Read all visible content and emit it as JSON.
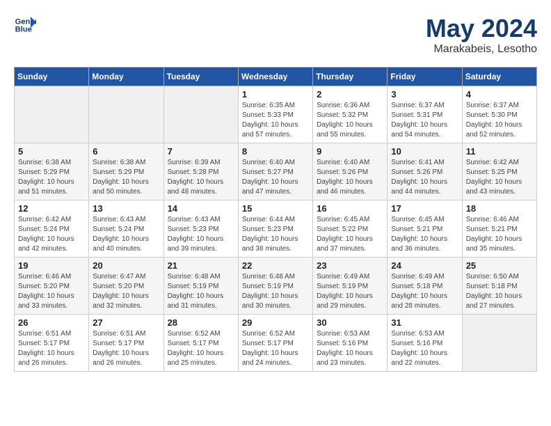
{
  "header": {
    "logo_line1": "General",
    "logo_line2": "Blue",
    "month": "May 2024",
    "location": "Marakabeis, Lesotho"
  },
  "weekdays": [
    "Sunday",
    "Monday",
    "Tuesday",
    "Wednesday",
    "Thursday",
    "Friday",
    "Saturday"
  ],
  "weeks": [
    [
      {
        "day": "",
        "empty": true
      },
      {
        "day": "",
        "empty": true
      },
      {
        "day": "",
        "empty": true
      },
      {
        "day": "1",
        "sunrise": "6:35 AM",
        "sunset": "5:33 PM",
        "daylight": "10 hours and 57 minutes."
      },
      {
        "day": "2",
        "sunrise": "6:36 AM",
        "sunset": "5:32 PM",
        "daylight": "10 hours and 55 minutes."
      },
      {
        "day": "3",
        "sunrise": "6:37 AM",
        "sunset": "5:31 PM",
        "daylight": "10 hours and 54 minutes."
      },
      {
        "day": "4",
        "sunrise": "6:37 AM",
        "sunset": "5:30 PM",
        "daylight": "10 hours and 52 minutes."
      }
    ],
    [
      {
        "day": "5",
        "sunrise": "6:38 AM",
        "sunset": "5:29 PM",
        "daylight": "10 hours and 51 minutes."
      },
      {
        "day": "6",
        "sunrise": "6:38 AM",
        "sunset": "5:29 PM",
        "daylight": "10 hours and 50 minutes."
      },
      {
        "day": "7",
        "sunrise": "6:39 AM",
        "sunset": "5:28 PM",
        "daylight": "10 hours and 48 minutes."
      },
      {
        "day": "8",
        "sunrise": "6:40 AM",
        "sunset": "5:27 PM",
        "daylight": "10 hours and 47 minutes."
      },
      {
        "day": "9",
        "sunrise": "6:40 AM",
        "sunset": "5:26 PM",
        "daylight": "10 hours and 46 minutes."
      },
      {
        "day": "10",
        "sunrise": "6:41 AM",
        "sunset": "5:26 PM",
        "daylight": "10 hours and 44 minutes."
      },
      {
        "day": "11",
        "sunrise": "6:42 AM",
        "sunset": "5:25 PM",
        "daylight": "10 hours and 43 minutes."
      }
    ],
    [
      {
        "day": "12",
        "sunrise": "6:42 AM",
        "sunset": "5:24 PM",
        "daylight": "10 hours and 42 minutes."
      },
      {
        "day": "13",
        "sunrise": "6:43 AM",
        "sunset": "5:24 PM",
        "daylight": "10 hours and 40 minutes."
      },
      {
        "day": "14",
        "sunrise": "6:43 AM",
        "sunset": "5:23 PM",
        "daylight": "10 hours and 39 minutes."
      },
      {
        "day": "15",
        "sunrise": "6:44 AM",
        "sunset": "5:23 PM",
        "daylight": "10 hours and 38 minutes."
      },
      {
        "day": "16",
        "sunrise": "6:45 AM",
        "sunset": "5:22 PM",
        "daylight": "10 hours and 37 minutes."
      },
      {
        "day": "17",
        "sunrise": "6:45 AM",
        "sunset": "5:21 PM",
        "daylight": "10 hours and 36 minutes."
      },
      {
        "day": "18",
        "sunrise": "6:46 AM",
        "sunset": "5:21 PM",
        "daylight": "10 hours and 35 minutes."
      }
    ],
    [
      {
        "day": "19",
        "sunrise": "6:46 AM",
        "sunset": "5:20 PM",
        "daylight": "10 hours and 33 minutes."
      },
      {
        "day": "20",
        "sunrise": "6:47 AM",
        "sunset": "5:20 PM",
        "daylight": "10 hours and 32 minutes."
      },
      {
        "day": "21",
        "sunrise": "6:48 AM",
        "sunset": "5:19 PM",
        "daylight": "10 hours and 31 minutes."
      },
      {
        "day": "22",
        "sunrise": "6:48 AM",
        "sunset": "5:19 PM",
        "daylight": "10 hours and 30 minutes."
      },
      {
        "day": "23",
        "sunrise": "6:49 AM",
        "sunset": "5:19 PM",
        "daylight": "10 hours and 29 minutes."
      },
      {
        "day": "24",
        "sunrise": "6:49 AM",
        "sunset": "5:18 PM",
        "daylight": "10 hours and 28 minutes."
      },
      {
        "day": "25",
        "sunrise": "6:50 AM",
        "sunset": "5:18 PM",
        "daylight": "10 hours and 27 minutes."
      }
    ],
    [
      {
        "day": "26",
        "sunrise": "6:51 AM",
        "sunset": "5:17 PM",
        "daylight": "10 hours and 26 minutes."
      },
      {
        "day": "27",
        "sunrise": "6:51 AM",
        "sunset": "5:17 PM",
        "daylight": "10 hours and 26 minutes."
      },
      {
        "day": "28",
        "sunrise": "6:52 AM",
        "sunset": "5:17 PM",
        "daylight": "10 hours and 25 minutes."
      },
      {
        "day": "29",
        "sunrise": "6:52 AM",
        "sunset": "5:17 PM",
        "daylight": "10 hours and 24 minutes."
      },
      {
        "day": "30",
        "sunrise": "6:53 AM",
        "sunset": "5:16 PM",
        "daylight": "10 hours and 23 minutes."
      },
      {
        "day": "31",
        "sunrise": "6:53 AM",
        "sunset": "5:16 PM",
        "daylight": "10 hours and 22 minutes."
      },
      {
        "day": "",
        "empty": true
      }
    ]
  ]
}
